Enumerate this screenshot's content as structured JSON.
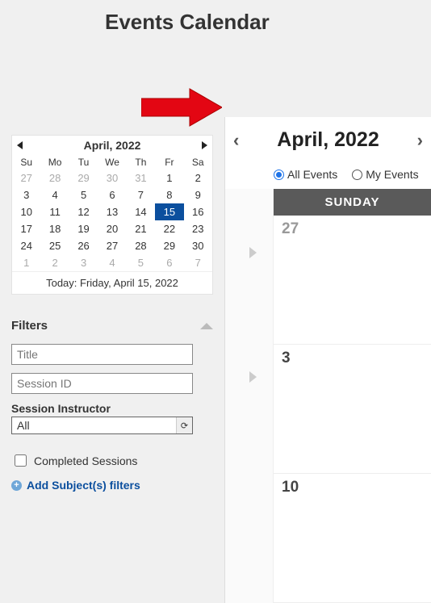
{
  "page_title": "Events Calendar",
  "mini_calendar": {
    "title": "April, 2022",
    "dow": [
      "Su",
      "Mo",
      "Tu",
      "We",
      "Th",
      "Fr",
      "Sa"
    ],
    "days": [
      {
        "n": 27,
        "muted": true
      },
      {
        "n": 28,
        "muted": true
      },
      {
        "n": 29,
        "muted": true
      },
      {
        "n": 30,
        "muted": true
      },
      {
        "n": 31,
        "muted": true
      },
      {
        "n": 1
      },
      {
        "n": 2
      },
      {
        "n": 3
      },
      {
        "n": 4
      },
      {
        "n": 5
      },
      {
        "n": 6
      },
      {
        "n": 7
      },
      {
        "n": 8
      },
      {
        "n": 9
      },
      {
        "n": 10
      },
      {
        "n": 11
      },
      {
        "n": 12
      },
      {
        "n": 13
      },
      {
        "n": 14
      },
      {
        "n": 15,
        "sel": true
      },
      {
        "n": 16
      },
      {
        "n": 17
      },
      {
        "n": 18
      },
      {
        "n": 19
      },
      {
        "n": 20
      },
      {
        "n": 21
      },
      {
        "n": 22
      },
      {
        "n": 23
      },
      {
        "n": 24
      },
      {
        "n": 25
      },
      {
        "n": 26
      },
      {
        "n": 27
      },
      {
        "n": 28
      },
      {
        "n": 29
      },
      {
        "n": 30
      },
      {
        "n": 1,
        "muted": true
      },
      {
        "n": 2,
        "muted": true
      },
      {
        "n": 3,
        "muted": true
      },
      {
        "n": 4,
        "muted": true
      },
      {
        "n": 5,
        "muted": true
      },
      {
        "n": 6,
        "muted": true
      },
      {
        "n": 7,
        "muted": true
      }
    ],
    "today_text": "Today: Friday, April 15, 2022"
  },
  "filters": {
    "header": "Filters",
    "title_placeholder": "Title",
    "session_placeholder": "Session ID",
    "instructor_label": "Session Instructor",
    "instructor_value": "All",
    "completed_label": "Completed Sessions",
    "add_link": "Add Subject(s) filters"
  },
  "big_calendar": {
    "title": "April, 2022",
    "all_events": "All Events",
    "my_events": "My Events",
    "column_header": "SUNDAY",
    "cells": [
      {
        "n": "27",
        "muted": true
      },
      {
        "n": "3"
      },
      {
        "n": "10"
      }
    ]
  }
}
